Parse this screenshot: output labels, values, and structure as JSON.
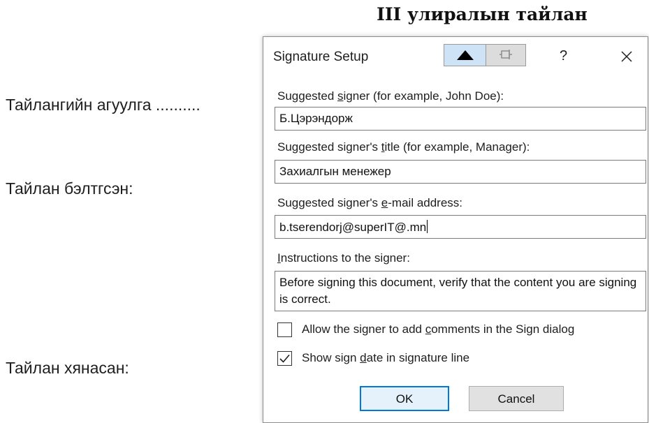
{
  "document": {
    "title": "III улиралын тайлан",
    "lines": [
      "Тайлангийн агуулга ..........",
      "Тайлан бэлтгсэн:",
      "Тайлан хянасан:"
    ]
  },
  "dialog": {
    "title": "Signature Setup",
    "titlebar_buttons": {
      "up_icon": "triangle-up-icon",
      "pin_icon": "pin-icon",
      "help": "?",
      "close_icon": "close-icon"
    },
    "fields": {
      "signer_label_pre": "Suggested ",
      "signer_label_u": "s",
      "signer_label_post": "igner (for example, John Doe):",
      "signer_value": "Б.Цэрэндорж",
      "title_label_pre": "Suggested signer's ",
      "title_label_u": "t",
      "title_label_post": "itle (for example, Manager):",
      "title_value": "Захиалгын менежер",
      "email_label_pre": "Suggested signer's ",
      "email_label_u": "e",
      "email_label_post": "-mail address:",
      "email_value": "b.tserendorj@superIT@.mn",
      "instructions_label_u": "I",
      "instructions_label_post": "nstructions to the signer:",
      "instructions_value": "Before signing this document, verify that the content you are signing is correct."
    },
    "checkboxes": {
      "allow_comments_pre": "Allow the signer to add ",
      "allow_comments_u": "c",
      "allow_comments_post": "omments in the Sign dialog",
      "allow_comments_checked": false,
      "show_date_pre": "Show sign ",
      "show_date_u": "d",
      "show_date_post": "ate in signature line",
      "show_date_checked": true
    },
    "buttons": {
      "ok": "OK",
      "cancel": "Cancel"
    },
    "colors": {
      "accent": "#0078d7",
      "ok_fill": "#e5f1fb",
      "up_button_fill": "#cfe3f7"
    }
  }
}
